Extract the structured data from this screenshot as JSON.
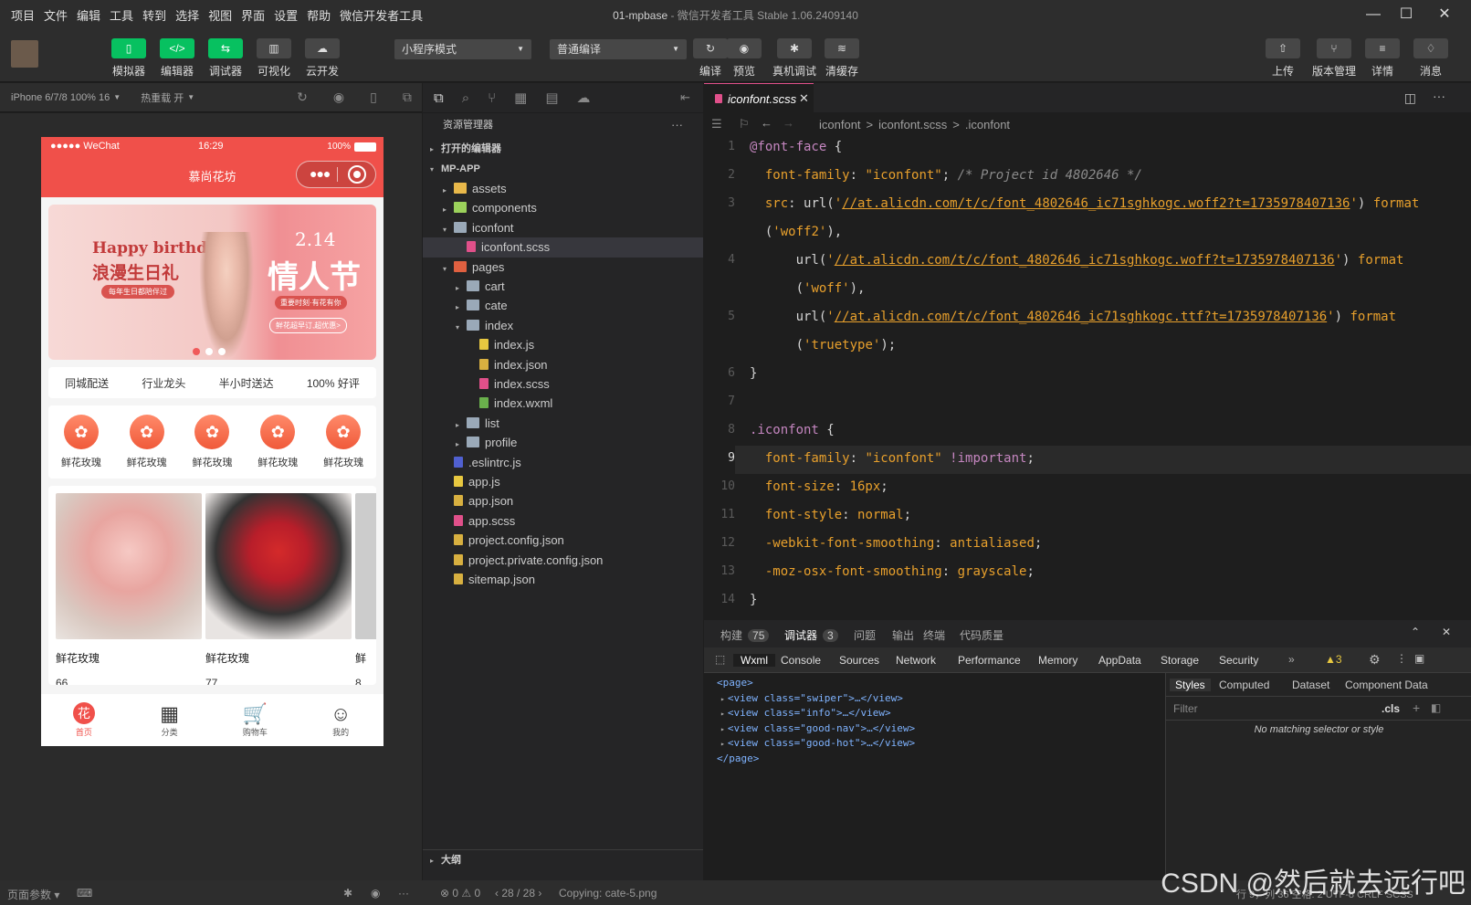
{
  "menu": [
    "项目",
    "文件",
    "编辑",
    "工具",
    "转到",
    "选择",
    "视图",
    "界面",
    "设置",
    "帮助",
    "微信开发者工具"
  ],
  "window": {
    "project": "01-mpbase",
    "suffix": " - 微信开发者工具 Stable 1.06.2409140"
  },
  "toolbar": {
    "left": [
      {
        "icon": "▯",
        "label": "模拟器"
      },
      {
        "icon": "</>",
        "label": "编辑器"
      },
      {
        "icon": "⇆",
        "label": "调试器"
      },
      {
        "icon": "▥",
        "label": "可视化"
      },
      {
        "icon": "☁",
        "label": "云开发"
      }
    ],
    "mode": "小程序模式",
    "compile": "普通编译",
    "mid": [
      {
        "icon": "↻",
        "label": "编译"
      },
      {
        "icon": "◉",
        "label": "预览"
      },
      {
        "icon": "✱",
        "label": "真机调试"
      },
      {
        "icon": "≋",
        "label": "清缓存"
      }
    ],
    "right": [
      {
        "icon": "⇧",
        "label": "上传"
      },
      {
        "icon": "⑂",
        "label": "版本管理"
      },
      {
        "icon": "≡",
        "label": "详情"
      },
      {
        "icon": "♢",
        "label": "消息"
      }
    ]
  },
  "sim": {
    "device": "iPhone 6/7/8 100% 16",
    "hotreload": "热重载 开"
  },
  "phone": {
    "status_left": "●●●●● WeChat",
    "time": "16:29",
    "battery": "100%",
    "title": "慕尚花坊",
    "banner": {
      "en": "Happy birthday",
      "cn": "浪漫生日礼",
      "sub": "每年生日都陪伴过",
      "date": "2.14",
      "vday": "情人节",
      "tag": "重要时刻·有花有你",
      "btn": "鲜花超早订,超优惠>"
    },
    "info": [
      "同城配送",
      "行业龙头",
      "半小时送达",
      "100% 好评"
    ],
    "nav": [
      "鲜花玫瑰",
      "鲜花玫瑰",
      "鲜花玫瑰",
      "鲜花玫瑰",
      "鲜花玫瑰"
    ],
    "goods": [
      {
        "name": "鲜花玫瑰",
        "price": "66"
      },
      {
        "name": "鲜花玫瑰",
        "price": "77"
      },
      {
        "name": "鲜",
        "price": "8"
      }
    ],
    "tabs": [
      {
        "icon": "花",
        "label": "首页"
      },
      {
        "icon": "▦",
        "label": "分类"
      },
      {
        "icon": "🛒",
        "label": "购物车"
      },
      {
        "icon": "☺",
        "label": "我的"
      }
    ]
  },
  "explorer": {
    "title": "资源管理器",
    "open_editors": "打开的编辑器",
    "root": "MP-APP",
    "items": [
      {
        "name": "assets",
        "depth": 1,
        "type": "folder",
        "arrow": "▸",
        "color": "#e8b84a"
      },
      {
        "name": "components",
        "depth": 1,
        "type": "folder",
        "arrow": "▸",
        "color": "#9bd15b"
      },
      {
        "name": "iconfont",
        "depth": 1,
        "type": "folder",
        "arrow": "▾",
        "color": "#9aa9b8"
      },
      {
        "name": "iconfont.scss",
        "depth": 2,
        "type": "file",
        "arrow": "",
        "color": "#e0508a",
        "selected": true
      },
      {
        "name": "pages",
        "depth": 1,
        "type": "folder",
        "arrow": "▾",
        "color": "#e06040"
      },
      {
        "name": "cart",
        "depth": 2,
        "type": "folder",
        "arrow": "▸",
        "color": "#9aa9b8"
      },
      {
        "name": "cate",
        "depth": 2,
        "type": "folder",
        "arrow": "▸",
        "color": "#9aa9b8"
      },
      {
        "name": "index",
        "depth": 2,
        "type": "folder",
        "arrow": "▾",
        "color": "#9aa9b8"
      },
      {
        "name": "index.js",
        "depth": 3,
        "type": "file",
        "arrow": "",
        "color": "#e8c840"
      },
      {
        "name": "index.json",
        "depth": 3,
        "type": "file",
        "arrow": "",
        "color": "#d8b040"
      },
      {
        "name": "index.scss",
        "depth": 3,
        "type": "file",
        "arrow": "",
        "color": "#e0508a"
      },
      {
        "name": "index.wxml",
        "depth": 3,
        "type": "file",
        "arrow": "",
        "color": "#6ab04c"
      },
      {
        "name": "list",
        "depth": 2,
        "type": "folder",
        "arrow": "▸",
        "color": "#9aa9b8"
      },
      {
        "name": "profile",
        "depth": 2,
        "type": "folder",
        "arrow": "▸",
        "color": "#9aa9b8"
      },
      {
        "name": ".eslintrc.js",
        "depth": 1,
        "type": "file",
        "arrow": "",
        "color": "#5060d0"
      },
      {
        "name": "app.js",
        "depth": 1,
        "type": "file",
        "arrow": "",
        "color": "#e8c840"
      },
      {
        "name": "app.json",
        "depth": 1,
        "type": "file",
        "arrow": "",
        "color": "#d8b040"
      },
      {
        "name": "app.scss",
        "depth": 1,
        "type": "file",
        "arrow": "",
        "color": "#e0508a"
      },
      {
        "name": "project.config.json",
        "depth": 1,
        "type": "file",
        "arrow": "",
        "color": "#d8b040"
      },
      {
        "name": "project.private.config.json",
        "depth": 1,
        "type": "file",
        "arrow": "",
        "color": "#d8b040"
      },
      {
        "name": "sitemap.json",
        "depth": 1,
        "type": "file",
        "arrow": "",
        "color": "#d8b040"
      }
    ],
    "outline": "大纲"
  },
  "editor": {
    "tab": "iconfont.scss",
    "crumb": [
      "iconfont",
      ">",
      "iconfont.scss",
      ">",
      ".iconfont"
    ],
    "lines": [
      {
        "n": "1",
        "html": "<span class='p'>@font-face</span> {"
      },
      {
        "n": "2",
        "html": "&nbsp;&nbsp;<span class='k'>font-family</span>: <span class='s'>\"iconfont\"</span>; <span class='c'>/* Project id 4802646 */</span>"
      },
      {
        "n": "3",
        "html": "&nbsp;&nbsp;<span class='k'>src</span>: url(<span class='s'>'</span><span class='u'>//at.alicdn.com/t/c/font_4802646_ic71sghkogc.woff2?t=1735978407136</span><span class='s'>'</span>) <span class='k'>format</span>"
      },
      {
        "n": "",
        "html": "&nbsp;&nbsp;(<span class='s'>'woff2'</span>),"
      },
      {
        "n": "4",
        "html": "&nbsp;&nbsp;&nbsp;&nbsp;&nbsp;&nbsp;url(<span class='s'>'</span><span class='u'>//at.alicdn.com/t/c/font_4802646_ic71sghkogc.woff?t=1735978407136</span><span class='s'>'</span>) <span class='k'>format</span>"
      },
      {
        "n": "",
        "html": "&nbsp;&nbsp;&nbsp;&nbsp;&nbsp;&nbsp;(<span class='s'>'woff'</span>),"
      },
      {
        "n": "5",
        "html": "&nbsp;&nbsp;&nbsp;&nbsp;&nbsp;&nbsp;url(<span class='s'>'</span><span class='u'>//at.alicdn.com/t/c/font_4802646_ic71sghkogc.ttf?t=1735978407136</span><span class='s'>'</span>) <span class='k'>format</span>"
      },
      {
        "n": "",
        "html": "&nbsp;&nbsp;&nbsp;&nbsp;&nbsp;&nbsp;(<span class='s'>'truetype'</span>);"
      },
      {
        "n": "6",
        "html": "}"
      },
      {
        "n": "7",
        "html": ""
      },
      {
        "n": "8",
        "html": "<span class='p'>.iconfont</span> {"
      },
      {
        "n": "9",
        "html": "&nbsp;&nbsp;<span class='k'>font-family</span>: <span class='s'>\"iconfont\"</span> <span class='p'>!important</span>;"
      },
      {
        "n": "10",
        "html": "&nbsp;&nbsp;<span class='k'>font-size</span>: <span class='s'>16px</span>;"
      },
      {
        "n": "11",
        "html": "&nbsp;&nbsp;<span class='k'>font-style</span>: <span class='s'>normal</span>;"
      },
      {
        "n": "12",
        "html": "&nbsp;&nbsp;<span class='k'>-webkit-font-smoothing</span>: <span class='s'>antialiased</span>;"
      },
      {
        "n": "13",
        "html": "&nbsp;&nbsp;<span class='k'>-moz-osx-font-smoothing</span>: <span class='s'>grayscale</span>;"
      },
      {
        "n": "14",
        "html": "}"
      }
    ]
  },
  "panel": {
    "tabs": [
      {
        "label": "构建",
        "badge": "75"
      },
      {
        "label": "调试器",
        "badge": "3"
      },
      {
        "label": "问题",
        "badge": ""
      },
      {
        "label": "输出",
        "badge": ""
      },
      {
        "label": "终端",
        "badge": ""
      },
      {
        "label": "代码质量",
        "badge": ""
      }
    ]
  },
  "devtools": {
    "tabs": [
      "Wxml",
      "Console",
      "Sources",
      "Network",
      "Performance",
      "Memory",
      "AppData",
      "Storage",
      "Security"
    ],
    "more": "»",
    "warn": "▲3",
    "wxml": [
      "<page>",
      "<view class=\"swiper\">…</view>",
      "<view class=\"info\">…</view>",
      "<view class=\"good-nav\">…</view>",
      "<view class=\"good-hot\">…</view>",
      "</page>"
    ],
    "style_tabs": [
      "Styles",
      "Computed",
      "Dataset",
      "Component Data"
    ],
    "filter": "Filter",
    "cls": ".cls",
    "plus": "+",
    "nomatch": "No matching selector or style"
  },
  "status": {
    "pageparams": "页面参数",
    "errors": "⊗ 0 ⚠ 0",
    "nav": "‹ 28 / 28 ›",
    "msg": "Copying: cate-5.png",
    "right": "行 9，列 36  空格: 2  UTF-8  CRLF  SCSS"
  },
  "watermark": "CSDN @然后就去远行吧"
}
